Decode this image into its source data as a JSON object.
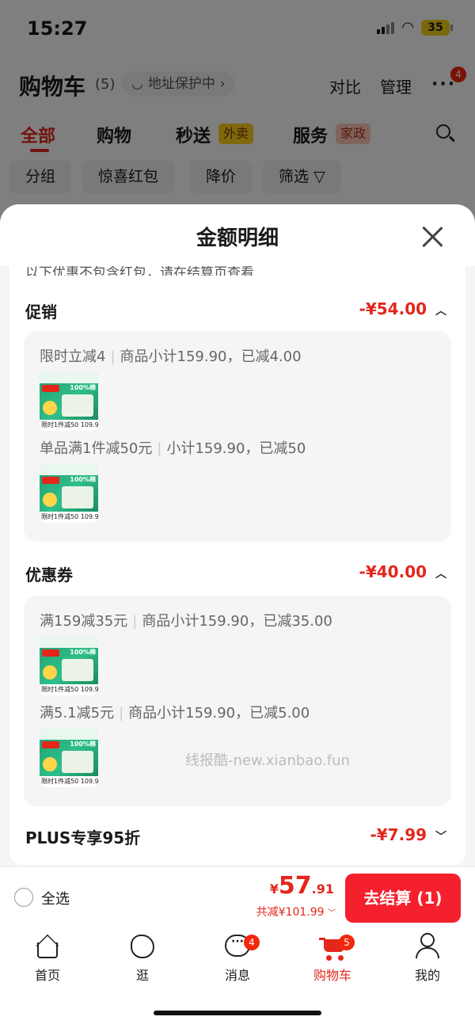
{
  "status": {
    "time": "15:27",
    "battery": "35"
  },
  "header": {
    "title": "购物车",
    "count": "(5)",
    "address_protect": "地址保护中",
    "compare": "对比",
    "manage": "管理",
    "more_badge": "4"
  },
  "tabs": [
    {
      "label": "全部"
    },
    {
      "label": "购物"
    },
    {
      "label": "秒送",
      "tag": "外卖"
    },
    {
      "label": "服务",
      "tag": "家政"
    }
  ],
  "filters": [
    "分组",
    "惊喜红包",
    "降价",
    "筛选"
  ],
  "sheet": {
    "title": "金额明细",
    "cut_note": "以下优惠不包含红包，请在结算页查看",
    "sections": [
      {
        "title": "促销",
        "amount": "-¥54.00",
        "lines": [
          {
            "name": "限时立减4",
            "desc": "商品小计159.90，已减4.00"
          },
          {
            "name": "单品满1件减50元",
            "desc": "小计159.90，已减50"
          }
        ]
      },
      {
        "title": "优惠券",
        "amount": "-¥40.00",
        "lines": [
          {
            "name": "满159减35元",
            "desc": "商品小计159.90，已减35.00"
          },
          {
            "name": "满5.1减5元",
            "desc": "商品小计159.90，已减5.00"
          }
        ]
      },
      {
        "title": "PLUS专享95折",
        "amount": "-¥7.99"
      }
    ],
    "product": {
      "top_text": "100%棉",
      "mid_text": "0添加 更柔55%",
      "bottom_label": "限时1件减50",
      "bottom_price": "109.9"
    },
    "watermark": "线报酷-new.xianbao.fun"
  },
  "bottom_bar": {
    "select_all": "全选",
    "yen": "¥",
    "price_int": "57",
    "price_dec": ".91",
    "total_saved": "共减¥101.99",
    "checkout": "去结算 (1)"
  },
  "tabbar": [
    {
      "label": "首页"
    },
    {
      "label": "逛"
    },
    {
      "label": "消息",
      "badge": "4"
    },
    {
      "label": "购物车",
      "badge": "5"
    },
    {
      "label": "我的"
    }
  ],
  "colors": {
    "accent": "#e4261b",
    "button": "#f5202d"
  }
}
